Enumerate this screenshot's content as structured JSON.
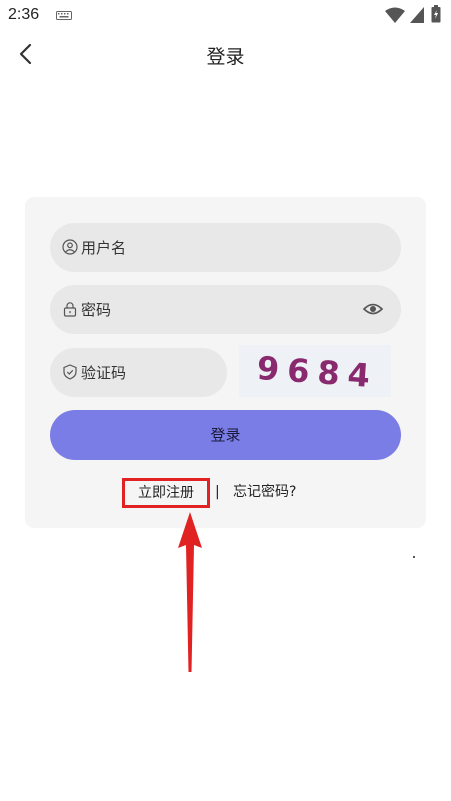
{
  "status_bar": {
    "time": "2:36"
  },
  "header": {
    "title": "登录"
  },
  "form": {
    "username_placeholder": "用户名",
    "password_placeholder": "密码",
    "captcha_placeholder": "验证码",
    "captcha_text": "9684",
    "login_label": "登录"
  },
  "links": {
    "register_label": "立即注册",
    "separator": "|",
    "forgot_label": "忘记密码?"
  },
  "colors": {
    "accent": "#7b7de6",
    "card_bg": "#f5f5f5",
    "field_bg": "#e8e8e8",
    "captcha_text": "#8a2a6e",
    "annotation": "#e02222"
  },
  "icons": {
    "back": "chevron-left-icon",
    "username": "user-icon",
    "password": "lock-icon",
    "captcha": "shield-icon",
    "toggle_password": "eye-icon"
  }
}
